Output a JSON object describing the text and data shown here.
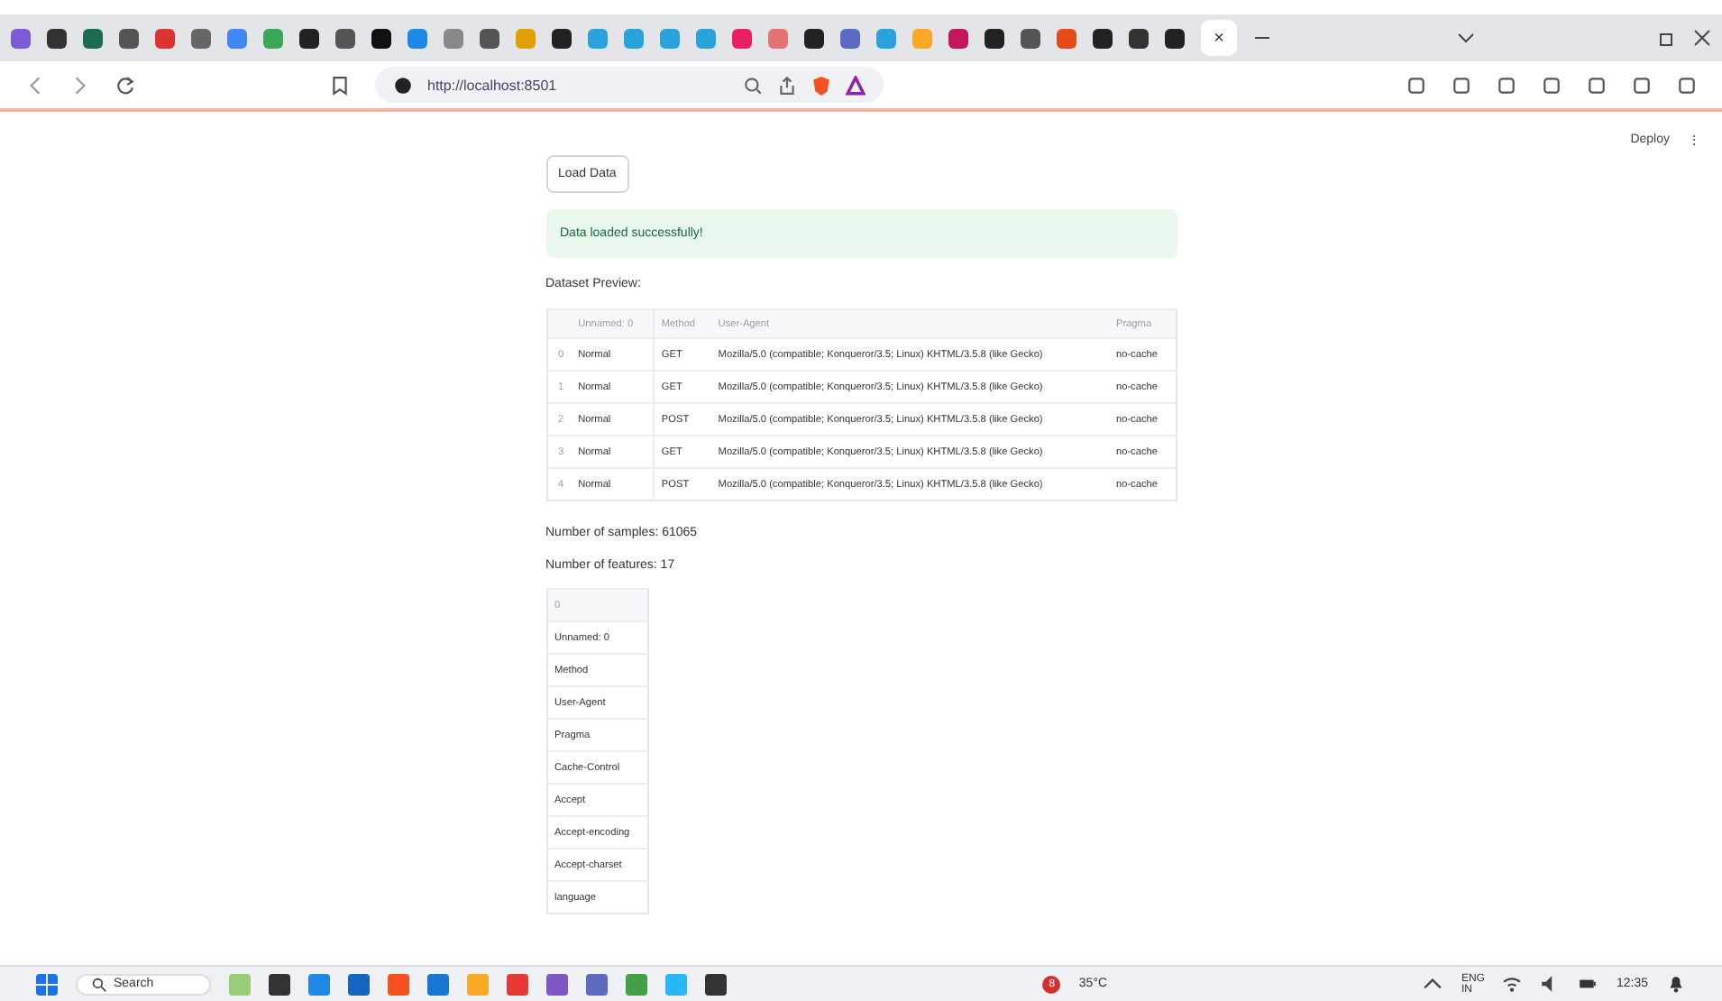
{
  "browser": {
    "tab_close": "×",
    "url": "http://localhost:8501"
  },
  "app": {
    "deploy": "Deploy",
    "menu": "⋮",
    "load_button": "Load Data",
    "alert": "Data loaded successfully!",
    "preview_title": "Dataset Preview:",
    "preview_table": {
      "columns": [
        "",
        "Unnamed: 0",
        "Method",
        "User-Agent",
        "Pragma"
      ],
      "rows": [
        [
          "0",
          "Normal",
          "GET",
          "Mozilla/5.0 (compatible; Konqueror/3.5; Linux) KHTML/3.5.8 (like Gecko)",
          "no-cache"
        ],
        [
          "1",
          "Normal",
          "GET",
          "Mozilla/5.0 (compatible; Konqueror/3.5; Linux) KHTML/3.5.8 (like Gecko)",
          "no-cache"
        ],
        [
          "2",
          "Normal",
          "POST",
          "Mozilla/5.0 (compatible; Konqueror/3.5; Linux) KHTML/3.5.8 (like Gecko)",
          "no-cache"
        ],
        [
          "3",
          "Normal",
          "GET",
          "Mozilla/5.0 (compatible; Konqueror/3.5; Linux) KHTML/3.5.8 (like Gecko)",
          "no-cache"
        ],
        [
          "4",
          "Normal",
          "POST",
          "Mozilla/5.0 (compatible; Konqueror/3.5; Linux) KHTML/3.5.8 (like Gecko)",
          "no-cache"
        ]
      ]
    },
    "samples": "Number of samples: 61065",
    "features": "Number of features: 17",
    "features_table": {
      "columns": [
        "0"
      ],
      "rows": [
        "Unnamed: 0",
        "Method",
        "User-Agent",
        "Pragma",
        "Cache-Control",
        "Accept",
        "Accept-encoding",
        "Accept-charset",
        "language"
      ]
    }
  },
  "taskbar": {
    "search": "Search",
    "weather_badge": "8",
    "weather_temp": "35°C",
    "lang": "ENG",
    "region": "IN",
    "time": "12:35"
  }
}
